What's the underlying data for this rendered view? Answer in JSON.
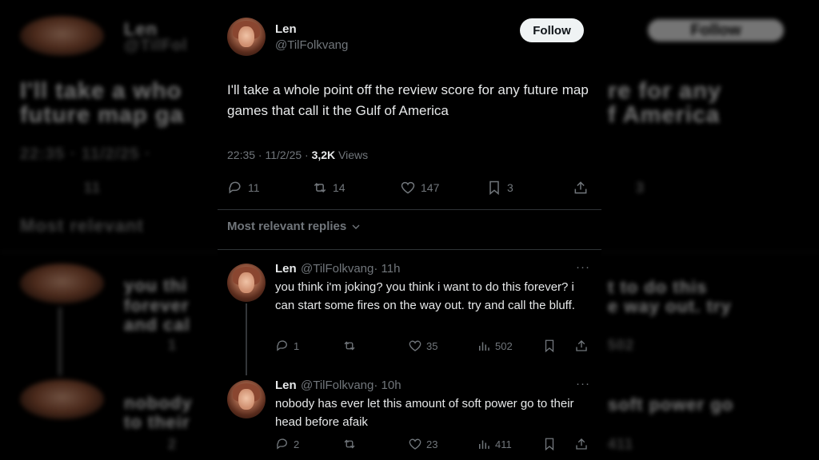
{
  "tweet": {
    "author_name": "Len",
    "author_handle": "@TilFolkvang",
    "follow_label": "Follow",
    "text": "I'll take a whole point off the review score for any future map games that call it the Gulf of America",
    "time": "22:35 · 11/2/25 · ",
    "views_count": "3,2K",
    "views_label": " Views",
    "replies": "11",
    "reposts": "14",
    "likes": "147",
    "bookmarks": "3"
  },
  "sort_label": "Most relevant replies",
  "replies": [
    {
      "name": "Len",
      "handle": "@TilFolkvang",
      "time": "· 11h",
      "text": "you think i'm joking? you think i want to do this forever? i can start some fires on the way out. try and call the bluff.",
      "replies": "1",
      "reposts": "",
      "likes": "35",
      "views": "502"
    },
    {
      "name": "Len",
      "handle": "@TilFolkvang",
      "time": "· 10h",
      "text": "nobody has ever let this amount of soft power go to their head before afaik",
      "replies": "2",
      "reposts": "",
      "likes": "23",
      "views": "411"
    }
  ],
  "background": {
    "name": "Len",
    "handle": "@TilFol",
    "follow": "Follow",
    "line1_left": "I'll take a who",
    "line2_left": "future map ga",
    "line1_right": "re for any",
    "line2_right": "f America",
    "time": "22:35 · 11/2/25 ·",
    "count_left": "11",
    "count_right": "3",
    "sort": "Most relevant",
    "r1_l1": "you thi",
    "r1_l2": "forever",
    "r1_l3": "and cal",
    "r1_r1": "t to do this",
    "r1_r2": "e way out. try",
    "r1_count": "1",
    "r1_views": "502",
    "r2_l1": "nobody",
    "r2_l2": "to their",
    "r2_r1": "soft power go",
    "r2_count": "2",
    "r2_views": "411"
  },
  "icons": [
    "reply-icon",
    "repost-icon",
    "like-icon",
    "bookmark-icon",
    "share-icon",
    "views-icon",
    "chevron-down-icon",
    "more-icon"
  ]
}
